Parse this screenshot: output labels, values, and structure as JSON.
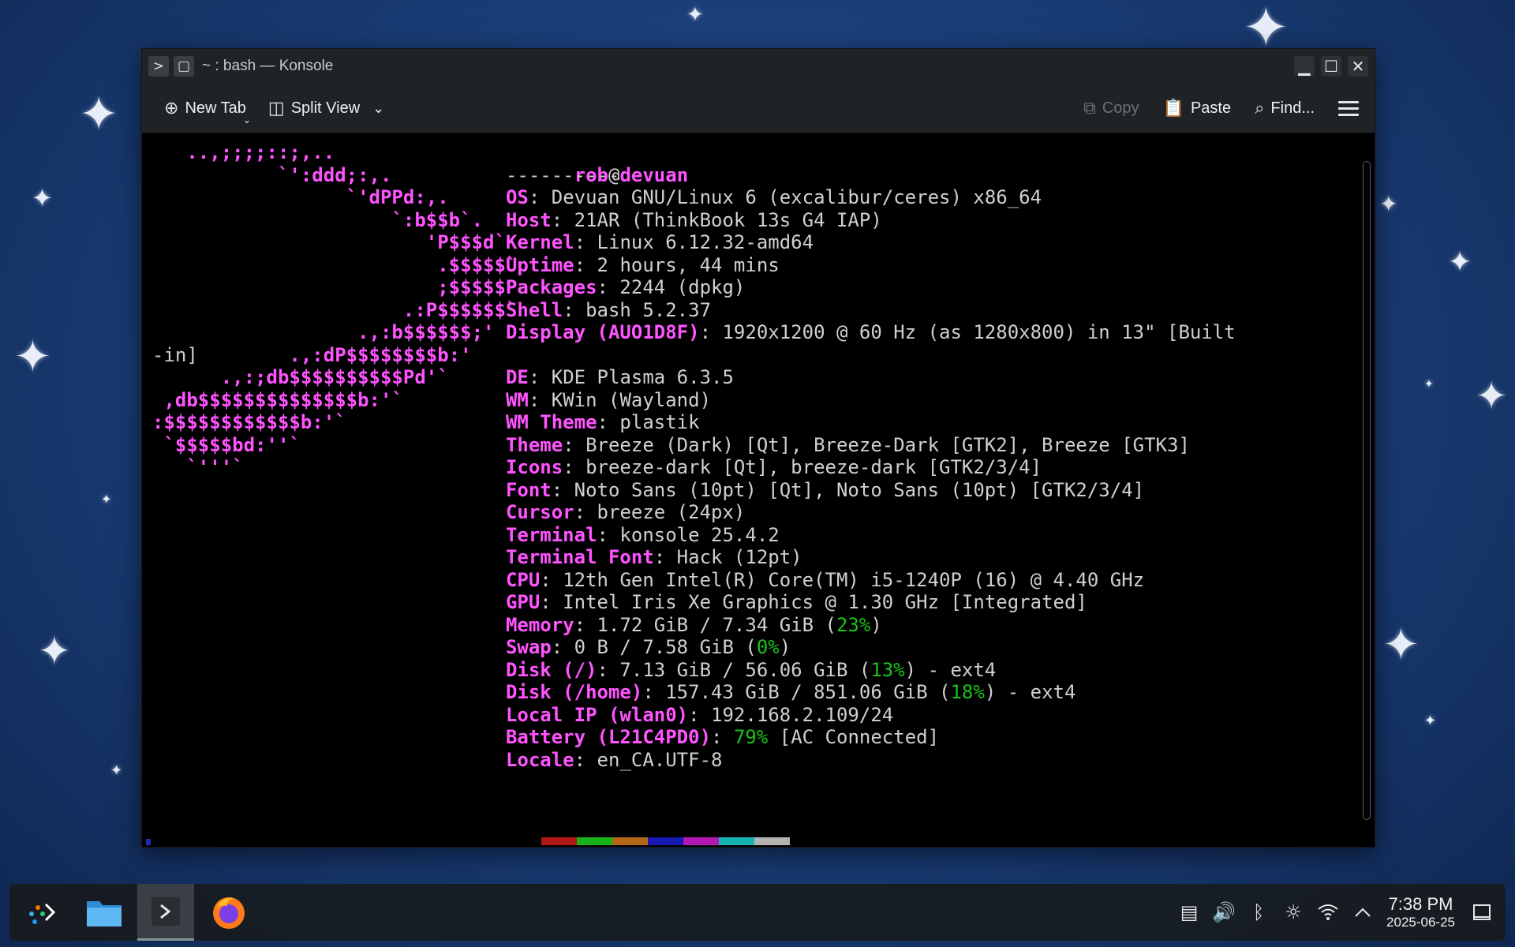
{
  "window": {
    "title": "~ : bash — Konsole"
  },
  "toolbar": {
    "new_tab": "New Tab",
    "split_view": "Split View",
    "copy": "Copy",
    "paste": "Paste",
    "find": "Find..."
  },
  "logo_lines": [
    "   ..,;;;;::;,..",
    "           `':ddd;:,.",
    "                 `'dPPd:,.",
    "                     `:b$$b`.",
    "                        'P$$$d`",
    "                         .$$$$$`",
    "                         ;$$$$$P",
    "                      .:P$$$$$$`",
    "                  .,:b$$$$$$;'",
    "-in]        .,:dP$$$$$$$$b:'",
    "      .,:;db$$$$$$$$$$Pd'`",
    " ,db$$$$$$$$$$$$$$b:'`",
    ":$$$$$$$$$$$$b:'`",
    " `$$$$$bd:''`",
    "   `'''`"
  ],
  "user": "rob",
  "at": "@",
  "host": "devuan",
  "separator": "----------",
  "info": [
    {
      "k": "OS",
      "v": ": Devuan GNU/Linux 6 (excalibur/ceres) x86_64"
    },
    {
      "k": "Host",
      "v": ": 21AR (ThinkBook 13s G4 IAP)"
    },
    {
      "k": "Kernel",
      "v": ": Linux 6.12.32-amd64"
    },
    {
      "k": "Uptime",
      "v": ": 2 hours, 44 mins"
    },
    {
      "k": "Packages",
      "v": ": 2244 (dpkg)"
    },
    {
      "k": "Shell",
      "v": ": bash 5.2.37"
    },
    {
      "k": "Display (AUO1D8F)",
      "v": ": 1920x1200 @ 60 Hz (as 1280x800) in 13\" [Built"
    },
    {
      "k": "DE",
      "v": ": KDE Plasma 6.3.5"
    },
    {
      "k": "WM",
      "v": ": KWin (Wayland)"
    },
    {
      "k": "WM Theme",
      "v": ": plastik"
    },
    {
      "k": "Theme",
      "v": ": Breeze (Dark) [Qt], Breeze-Dark [GTK2], Breeze [GTK3]"
    },
    {
      "k": "Icons",
      "v": ": breeze-dark [Qt], breeze-dark [GTK2/3/4]"
    },
    {
      "k": "Font",
      "v": ": Noto Sans (10pt) [Qt], Noto Sans (10pt) [GTK2/3/4]"
    },
    {
      "k": "Cursor",
      "v": ": breeze (24px)"
    },
    {
      "k": "Terminal",
      "v": ": konsole 25.4.2"
    },
    {
      "k": "Terminal Font",
      "v": ": Hack (12pt)"
    },
    {
      "k": "CPU",
      "v": ": 12th Gen Intel(R) Core(TM) i5-1240P (16) @ 4.40 GHz"
    },
    {
      "k": "GPU",
      "v": ": Intel Iris Xe Graphics @ 1.30 GHz [Integrated]"
    },
    {
      "k": "Memory",
      "v": ": 1.72 GiB / 7.34 GiB (",
      "g": "23%",
      "v2": ")"
    },
    {
      "k": "Swap",
      "v": ": 0 B / 7.58 GiB (",
      "g": "0%",
      "v2": ")"
    },
    {
      "k": "Disk (/)",
      "v": ": 7.13 GiB / 56.06 GiB (",
      "g": "13%",
      "v2": ") - ext4"
    },
    {
      "k": "Disk (/home)",
      "v": ": 157.43 GiB / 851.06 GiB (",
      "g": "18%",
      "v2": ") - ext4"
    },
    {
      "k": "Local IP (wlan0)",
      "v": ": 192.168.2.109/24"
    },
    {
      "k": "Battery (L21C4PD0)",
      "v": ": ",
      "g": "79%",
      "v2": " [AC Connected]"
    },
    {
      "k": "Locale",
      "v": ": en_CA.UTF-8"
    }
  ],
  "palette_top": [
    "#000000",
    "#b21818",
    "#18b218",
    "#b26818",
    "#1818b2",
    "#b218b2",
    "#18b2b2",
    "#b2b2b2"
  ],
  "palette_bottom": [
    "#686868",
    "#ff5454",
    "#54ff54",
    "#ffff54",
    "#5454ff",
    "#ff54ff",
    "#54ffff",
    "#ffffff"
  ],
  "taskbar": {
    "apps": [
      "application-launcher-icon",
      "file-manager-icon",
      "konsole-icon",
      "firefox-icon"
    ],
    "time": "7:38 PM",
    "date": "2025-06-25"
  }
}
